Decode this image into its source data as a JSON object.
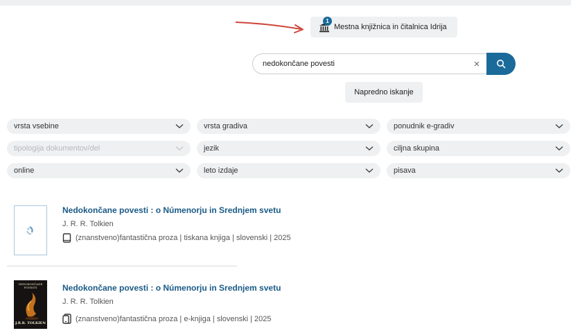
{
  "library": {
    "name": "Mestna knjižnica in čitalnica Idrija",
    "badge_count": "1",
    "icon": "library-building-icon"
  },
  "search": {
    "value": "nedokončane povesti",
    "clear_icon": "×",
    "search_icon": "search-icon"
  },
  "advanced_search_label": "Napredno iskanje",
  "filters": {
    "row1": [
      "vrsta vsebine",
      "vrsta gradiva",
      "ponudnik e-gradiv"
    ],
    "row2": [
      "tipologija dokumentov/del",
      "jezik",
      "ciljna skupina"
    ],
    "row3": [
      "online",
      "leto izdaje",
      "pisava"
    ]
  },
  "results": [
    {
      "title": "Nedokončane povesti : o Númenorju in Srednjem svetu",
      "author": "J. R. R. Tolkien",
      "meta": "(znanstveno)fantastična proza | tiskana knjiga | slovenski | 2025",
      "format_icon": "book-icon"
    },
    {
      "title": "Nedokončane povesti : o Númenorju in Srednjem svetu",
      "author": "J. R. R. Tolkien",
      "meta": "(znanstveno)fantastična proza | e-knjiga | slovenski | 2025",
      "format_icon": "ebook-icon",
      "cover_text": [
        "NEDOKONČANE",
        "POVESTI",
        "J.R.R. TOLKIEN"
      ]
    }
  ],
  "colors": {
    "accent": "#1a6a9a",
    "title_link": "#1a5a86",
    "annotation_arrow": "#d0453a",
    "filter_bg": "#eef0f2"
  }
}
